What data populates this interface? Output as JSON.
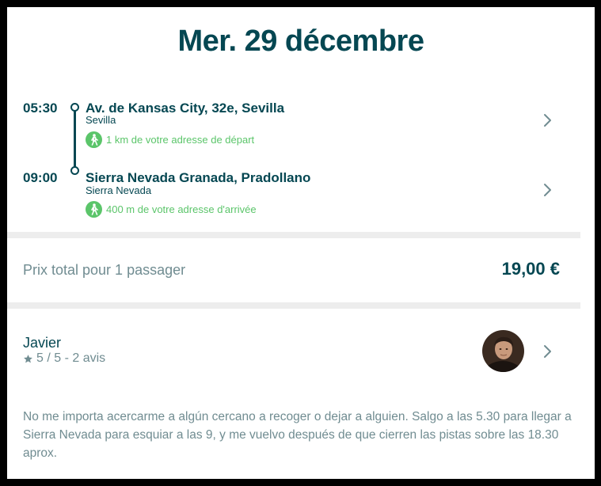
{
  "header": {
    "date": "Mer. 29 décembre"
  },
  "itinerary": {
    "departure": {
      "time": "05:30",
      "place": "Av. de Kansas City, 32e, Sevilla",
      "city": "Sevilla",
      "walk_distance": "1 km de votre adresse de départ"
    },
    "arrival": {
      "time": "09:00",
      "place": "Sierra Nevada Granada, Pradollano",
      "city": "Sierra Nevada",
      "walk_distance": "400 m de votre adresse d'arrivée"
    }
  },
  "price": {
    "label": "Prix total pour 1 passager",
    "value": "19,00 €"
  },
  "driver": {
    "name": "Javier",
    "rating": "5 / 5 - 2 avis",
    "description": "No me importa acercarme a algún cercano a recoger o dejar a alguien. Salgo a las 5.30 para llegar a Sierra Nevada para esquiar a las 9, y me vuelvo después de que cierren las pistas sobre las 18.30 aprox."
  },
  "colors": {
    "primary": "#054752",
    "secondary_text": "#708c91",
    "walk_green": "#5bc56a",
    "divider": "#ededed"
  },
  "icons": [
    "walking-person-icon",
    "chevron-right-icon",
    "star-icon"
  ]
}
